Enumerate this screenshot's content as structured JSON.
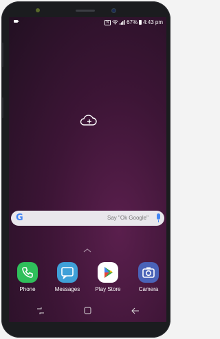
{
  "status_bar": {
    "battery_percent": "67%",
    "time": "4:43 pm",
    "icons": [
      "video-icon",
      "nfc-icon",
      "wifi-icon",
      "signal-icon",
      "battery-icon"
    ]
  },
  "home": {
    "cloud_add_icon": "cloud-plus-icon"
  },
  "search_bar": {
    "logo": "G",
    "placeholder": "Say \"Ok Google\""
  },
  "dock": {
    "apps": [
      {
        "label": "Phone",
        "icon": "phone-icon",
        "color": "#2fbf5b"
      },
      {
        "label": "Messages",
        "icon": "messages-icon",
        "color": "#3fa0d8"
      },
      {
        "label": "Play Store",
        "icon": "play-store-icon",
        "color": "#ffffff"
      },
      {
        "label": "Camera",
        "icon": "camera-icon",
        "color": "#4a63b8"
      }
    ]
  },
  "navigation": {
    "buttons": [
      "recent-apps-icon",
      "home-icon",
      "back-icon"
    ]
  }
}
